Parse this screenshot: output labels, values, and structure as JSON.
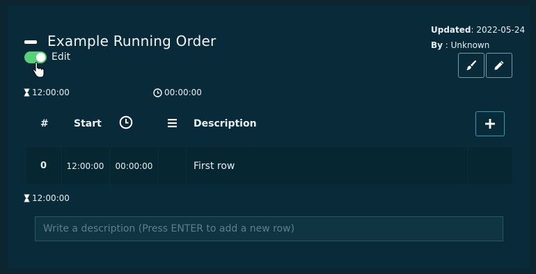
{
  "header": {
    "title": "Example Running Order",
    "edit_label": "Edit",
    "edit_enabled": true
  },
  "meta": {
    "updated_label": "Updated",
    "updated_value": ": 2022-05-24",
    "by_label": "By",
    "by_value": " : Unknown"
  },
  "stats": {
    "duration_top": "12:00:00",
    "clock_top": "00:00:00",
    "duration_bottom": "12:00:00"
  },
  "table": {
    "headers": {
      "number": "#",
      "start": "Start",
      "description": "Description"
    },
    "rows": [
      {
        "number": "0",
        "start": "12:00:00",
        "duration": "00:00:00",
        "description": "First row"
      }
    ]
  },
  "input": {
    "placeholder": "Write a description (Press ENTER to add a new row)",
    "value": ""
  },
  "colors": {
    "background": "#092a38",
    "toggle_on": "#57d07a",
    "accent_border": "#2c9db3"
  },
  "icons": [
    "minus-icon",
    "cursor-hand-icon",
    "brush-icon",
    "pencil-icon",
    "hourglass-icon",
    "clock-icon",
    "list-icon",
    "plus-icon"
  ]
}
